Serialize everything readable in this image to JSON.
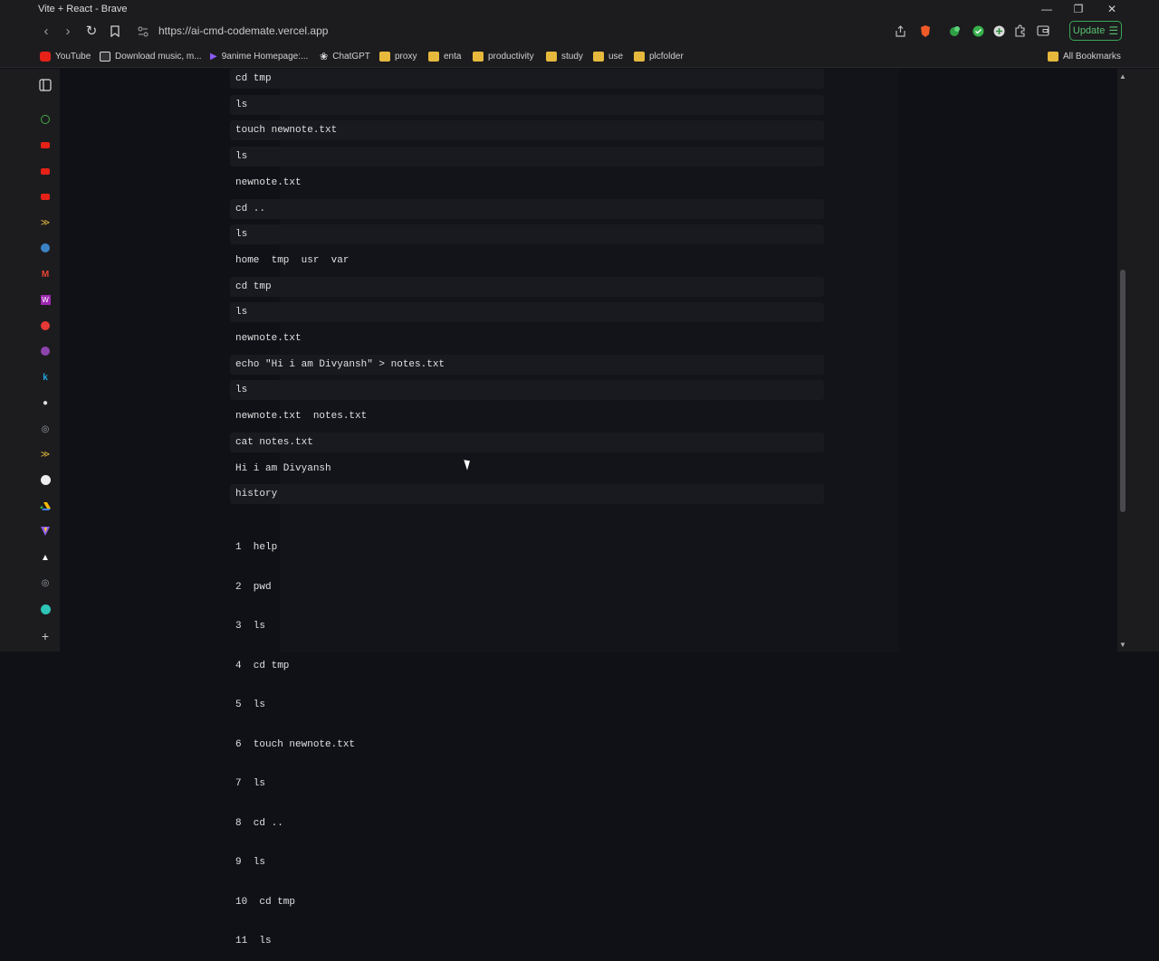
{
  "window": {
    "title": "Vite + React - Brave"
  },
  "address": {
    "url": "https://ai-cmd-codemate.vercel.app",
    "update_label": "Update"
  },
  "bookmarks": [
    {
      "label": "YouTube",
      "icon": "youtube-icon"
    },
    {
      "label": "Download music, m...",
      "icon": "download-icon"
    },
    {
      "label": "9anime Homepage:...",
      "icon": "9anime-icon"
    },
    {
      "label": "ChatGPT",
      "icon": "chatgpt-icon"
    },
    {
      "label": "proxy",
      "icon": "folder-icon"
    },
    {
      "label": "enta",
      "icon": "folder-icon"
    },
    {
      "label": "productivity",
      "icon": "folder-icon"
    },
    {
      "label": "study",
      "icon": "folder-icon"
    },
    {
      "label": "use",
      "icon": "folder-icon"
    },
    {
      "label": "plcfolder",
      "icon": "folder-icon"
    },
    {
      "label": "All Bookmarks",
      "icon": "folder-icon"
    }
  ],
  "terminal": {
    "lines": [
      {
        "text": "cd tmp",
        "kind": "cmd"
      },
      {
        "text": "ls",
        "kind": "cmd"
      },
      {
        "text": "touch newnote.txt",
        "kind": "cmd"
      },
      {
        "text": "ls",
        "kind": "cmd"
      },
      {
        "text": "newnote.txt",
        "kind": "out"
      },
      {
        "text": "cd ..",
        "kind": "cmd"
      },
      {
        "text": "ls",
        "kind": "cmd"
      },
      {
        "text": "home  tmp  usr  var",
        "kind": "out"
      },
      {
        "text": "cd tmp",
        "kind": "cmd"
      },
      {
        "text": "ls",
        "kind": "cmd"
      },
      {
        "text": "newnote.txt",
        "kind": "out"
      },
      {
        "text": "echo \"Hi i am Divyansh\" > notes.txt",
        "kind": "cmd"
      },
      {
        "text": "ls",
        "kind": "cmd"
      },
      {
        "text": "newnote.txt  notes.txt",
        "kind": "out"
      },
      {
        "text": "cat notes.txt",
        "kind": "cmd"
      },
      {
        "text": "Hi i am Divyansh",
        "kind": "out"
      },
      {
        "text": "history",
        "kind": "cmd"
      }
    ],
    "history": [
      "1  help",
      "2  pwd",
      "3  ls",
      "4  cd tmp",
      "5  ls",
      "6  touch newnote.txt",
      "7  ls",
      "8  cd ..",
      "9  ls",
      "10  cd tmp",
      "11  ls"
    ]
  }
}
